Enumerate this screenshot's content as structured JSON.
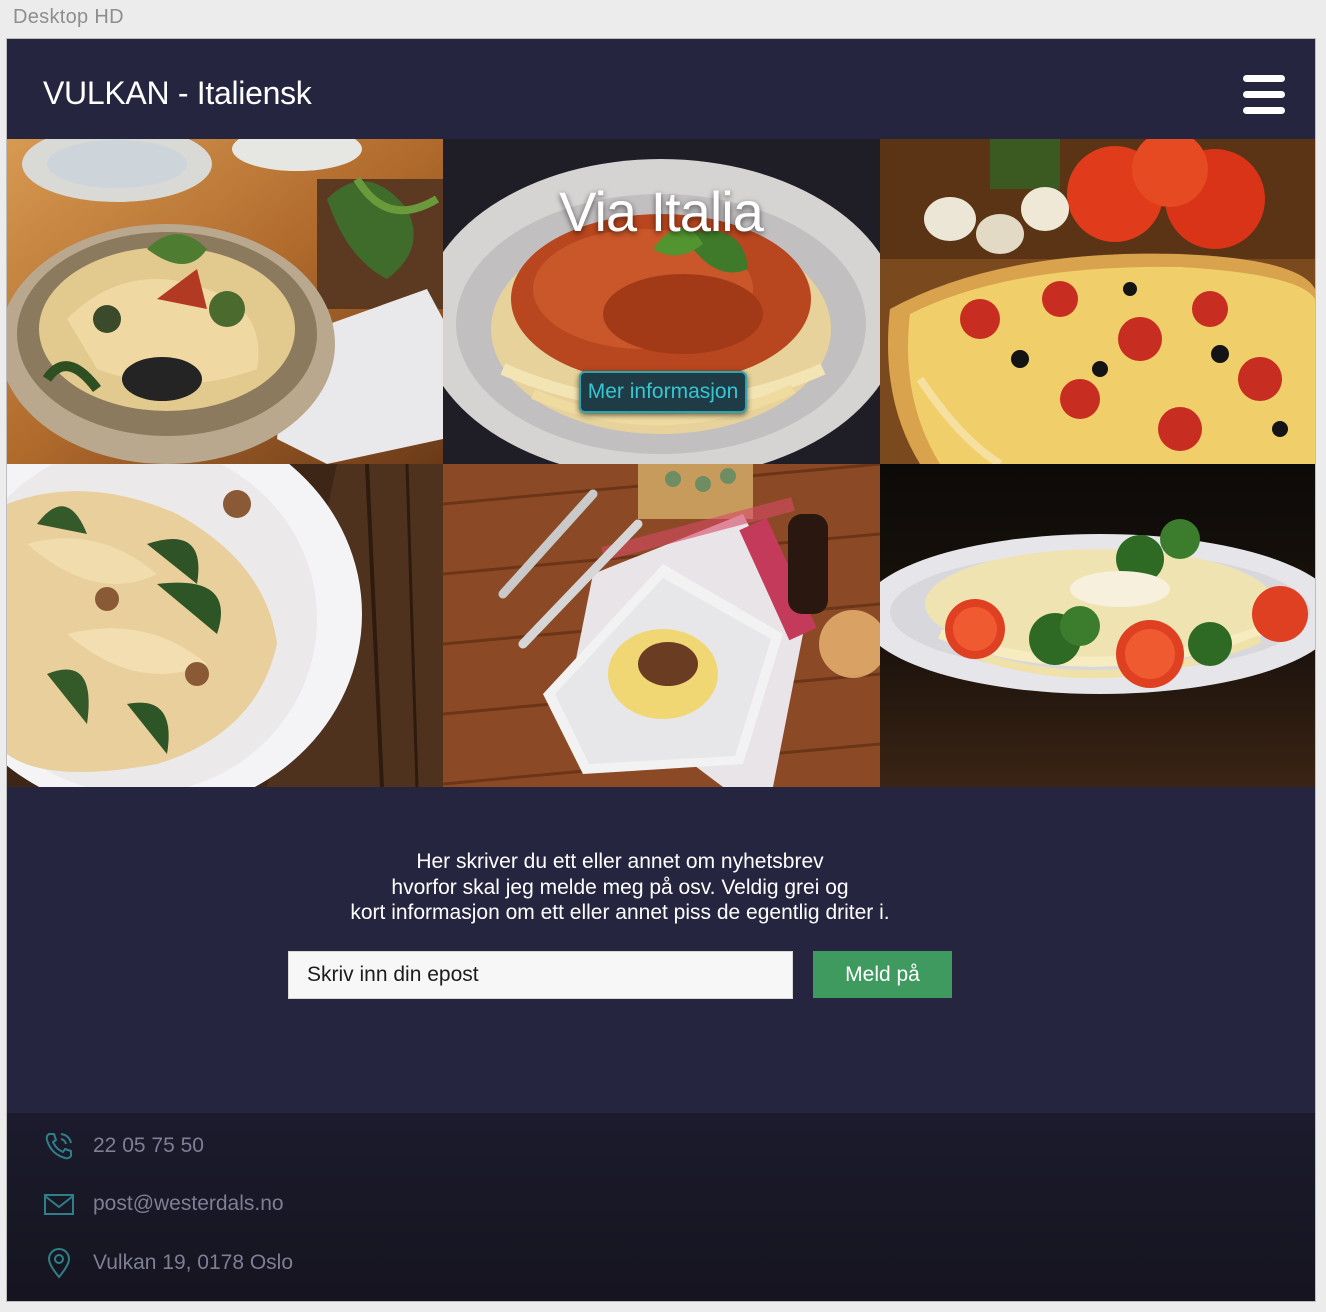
{
  "artboard": {
    "label": "Desktop HD"
  },
  "header": {
    "brand": "VULKAN - Italiensk",
    "menu_icon": "hamburger-menu-icon"
  },
  "hero": {
    "title": "Via Italia",
    "button_label": "Mer informasjon"
  },
  "gallery": {
    "photos": [
      "pasta-bowl-photo",
      "spaghetti-bolognese-photo",
      "pizza-photo",
      "pappardelle-photo",
      "penne-plate-photo",
      "spaghetti-broccoli-photo"
    ]
  },
  "newsletter": {
    "lines": [
      "Her skriver du ett eller annet om nyhetsbrev",
      "hvorfor skal jeg melde meg på osv. Veldig grei og",
      "kort informasjon om ett eller annet piss de egentlig driter i."
    ],
    "email_placeholder": "Skriv inn din epost",
    "button_label": "Meld på"
  },
  "footer": {
    "phone": "22 05 75 50",
    "email": "post@westerdals.no",
    "address": "Vulkan 19, 0178 Oslo"
  },
  "colors": {
    "page_bg": "#262540",
    "accent_teal": "#2aa6b3",
    "button_green": "#3e9a5e",
    "footer_bg": "#1a1928"
  }
}
